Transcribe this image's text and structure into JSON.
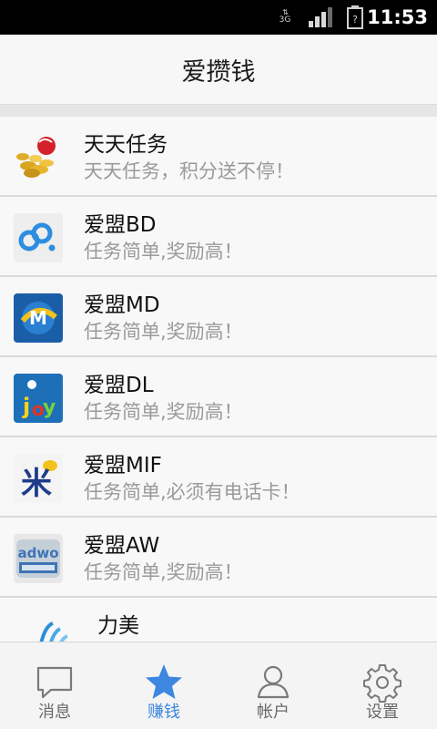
{
  "status_bar": {
    "network": "3G",
    "time": "11:53"
  },
  "header": {
    "title": "爱攒钱"
  },
  "list": {
    "items": [
      {
        "name": "天天任务",
        "desc": "天天任务，积分送不停！",
        "icon": "coins-icon"
      },
      {
        "name": "爱盟BD",
        "desc": "任务简单,奖励高！",
        "icon": "bd-logo-icon"
      },
      {
        "name": "爱盟MD",
        "desc": "任务简单,奖励高！",
        "icon": "md-logo-icon"
      },
      {
        "name": "爱盟DL",
        "desc": "任务简单,奖励高！",
        "icon": "dl-logo-icon"
      },
      {
        "name": "爱盟MIF",
        "desc": "任务简单,必须有电话卡！",
        "icon": "mif-logo-icon"
      },
      {
        "name": "爱盟AW",
        "desc": "任务简单,奖励高！",
        "icon": "adwo-logo-icon"
      },
      {
        "name": "力美",
        "desc": "",
        "icon": "limei-logo-icon"
      }
    ]
  },
  "bottom_nav": {
    "active_color": "#3d87e0",
    "items": [
      {
        "label": "消息",
        "icon": "message-icon"
      },
      {
        "label": "赚钱",
        "icon": "star-icon"
      },
      {
        "label": "帐户",
        "icon": "user-icon"
      },
      {
        "label": "设置",
        "icon": "gear-icon"
      }
    ]
  }
}
